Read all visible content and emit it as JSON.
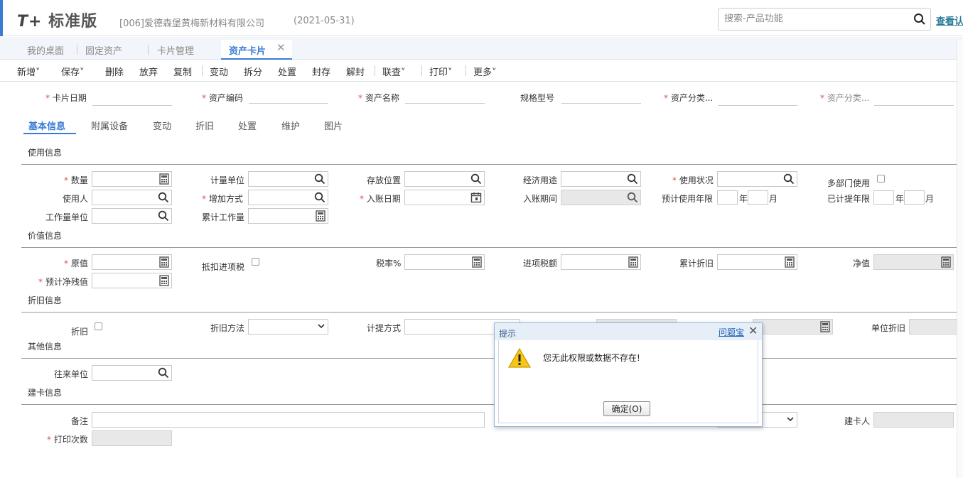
{
  "header": {
    "logo_mark": "T+",
    "logo_text": "标准版",
    "company": "[006]爱德森堡黄梅新材料有限公司",
    "date": "(2021-05-31)",
    "search_placeholder": "搜索-产品功能",
    "view_link": "查看认"
  },
  "tabs": [
    {
      "label": "我的桌面"
    },
    {
      "label": "固定资产"
    },
    {
      "label": "卡片管理"
    },
    {
      "label": "资产卡片",
      "active": true
    }
  ],
  "toolbar": [
    {
      "label": "新增",
      "dropdown": true
    },
    {
      "label": "保存",
      "dropdown": true
    },
    {
      "label": "删除"
    },
    {
      "label": "放弃"
    },
    {
      "label": "复制"
    },
    {
      "label": "变动"
    },
    {
      "label": "拆分"
    },
    {
      "label": "处置"
    },
    {
      "label": "封存"
    },
    {
      "label": "解封"
    },
    {
      "label": "联查",
      "dropdown": true
    },
    {
      "label": "打印",
      "dropdown": true
    },
    {
      "label": "更多",
      "dropdown": true
    }
  ],
  "head_fields": {
    "card_date": "卡片日期",
    "asset_code": "资产编码",
    "asset_name": "资产名称",
    "spec_model": "规格型号",
    "asset_class1": "资产分类...",
    "asset_class2": "资产分类..."
  },
  "subtabs": [
    "基本信息",
    "附属设备",
    "变动",
    "折旧",
    "处置",
    "维护",
    "图片"
  ],
  "sections": {
    "usage": "使用信息",
    "value": "价值信息",
    "depreciation": "折旧信息",
    "other": "其他信息",
    "build": "建卡信息"
  },
  "usage": {
    "quantity": "数量",
    "unit": "计量单位",
    "location": "存放位置",
    "economic_use": "经济用途",
    "use_status": "使用状况",
    "multi_dept": "多部门使用",
    "user": "使用人",
    "add_method": "增加方式",
    "entry_date": "入账日期",
    "entry_period": "入账期间",
    "expected_years": "预计使用年限",
    "accrued_years": "已计提年限",
    "year": "年",
    "month": "月",
    "workload_unit": "工作量单位",
    "total_workload": "累计工作量"
  },
  "value": {
    "original": "原值",
    "deduct_tax": "抵扣进项税",
    "tax_rate": "税率%",
    "input_tax": "进项税额",
    "acc_depr": "累计折旧",
    "net": "净值",
    "residual": "预计净残值"
  },
  "depr": {
    "depr": "折旧",
    "method": "折旧方法",
    "accrual": "计提方式",
    "unit_depr": "单位折旧"
  },
  "other": {
    "partner": "往来单位"
  },
  "build": {
    "remark": "备注",
    "creator": "建卡人",
    "print_count": "打印次数"
  },
  "dialog": {
    "title": "提示",
    "help_link": "问题宝",
    "message": "您无此权限或数据不存在!",
    "ok": "确定(O)"
  }
}
